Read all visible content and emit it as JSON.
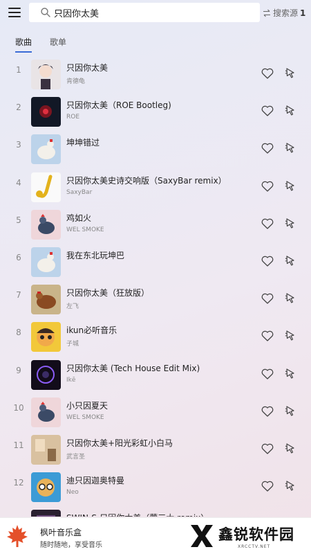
{
  "search": {
    "value": "只因你太美",
    "source_label": "搜索源",
    "source_num": "1"
  },
  "tabs": [
    {
      "label": "歌曲",
      "active": true
    },
    {
      "label": "歌单",
      "active": false
    }
  ],
  "songs": [
    {
      "index": "1",
      "title": "只因你太美",
      "artist": "肯德龟",
      "cover": "anime-portrait"
    },
    {
      "index": "2",
      "title": "只因你太美（ROE Bootleg)",
      "artist": "ROE",
      "cover": "dark-red-glow"
    },
    {
      "index": "3",
      "title": "坤坤错过",
      "artist": "",
      "cover": "white-chicken"
    },
    {
      "index": "4",
      "title": "只因你太美史诗交响版（SaxyBar remix）",
      "artist": "SaxyBar",
      "cover": "saxophone"
    },
    {
      "index": "5",
      "title": "鸡如火",
      "artist": "WEL SMOKE",
      "cover": "rooster-pink"
    },
    {
      "index": "6",
      "title": "我在东北玩坤巴",
      "artist": "",
      "cover": "white-chicken"
    },
    {
      "index": "7",
      "title": "只因你太美（狂放版）",
      "artist": "左飞",
      "cover": "brown-hen"
    },
    {
      "index": "8",
      "title": "ikun必听音乐",
      "artist": "子城",
      "cover": "cartoon-face"
    },
    {
      "index": "9",
      "title": "只因你太美 (Tech House Edit Mix)",
      "artist": "Ikē",
      "cover": "dark-purple"
    },
    {
      "index": "10",
      "title": "小只因夏天",
      "artist": "WEL SMOKE",
      "cover": "rooster-pink"
    },
    {
      "index": "11",
      "title": "只因你太美+阳光彩虹小白马",
      "artist": "武言圣",
      "cover": "warm-room"
    },
    {
      "index": "12",
      "title": "迪只因迦奥特曼",
      "artist": "Neo",
      "cover": "cartoon-glasses"
    },
    {
      "index": "",
      "title": "SWIN-S-只因你太美（蒙三大 remix）",
      "artist": "",
      "cover": "partial-dark"
    }
  ],
  "bottom": {
    "app_name": "枫叶音乐盒",
    "app_slogan": "随时随地，享受音乐",
    "watermark_text": "鑫锐软件园",
    "watermark_sub": "XRCCTV.NET"
  },
  "colors": {
    "accent": "#3a6bd6",
    "logo_red": "#e4502a"
  }
}
